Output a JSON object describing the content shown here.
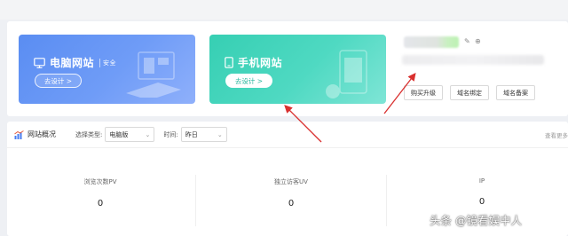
{
  "cards": {
    "pc": {
      "title": "电脑网站",
      "badge": "安全",
      "button": "去设计 >"
    },
    "mobile": {
      "title": "手机网站",
      "button": "去设计 >"
    }
  },
  "site_actions": [
    "购买升级",
    "域名绑定",
    "域名备案"
  ],
  "overview": {
    "title": "网站概况",
    "type_label": "选择类型:",
    "type_value": "电脑版",
    "time_label": "时间:",
    "time_value": "昨日",
    "view_more": "查看更多"
  },
  "stats": [
    {
      "label": "浏览次数PV",
      "value": "0"
    },
    {
      "label": "独立访客UV",
      "value": "0"
    },
    {
      "label": "IP",
      "value": "0"
    }
  ],
  "watermark": "头条 @镜看娱中人",
  "colors": {
    "pc_card": "#5a8df2",
    "mobile_card": "#36cfb3",
    "arrow": "#d9302f"
  }
}
